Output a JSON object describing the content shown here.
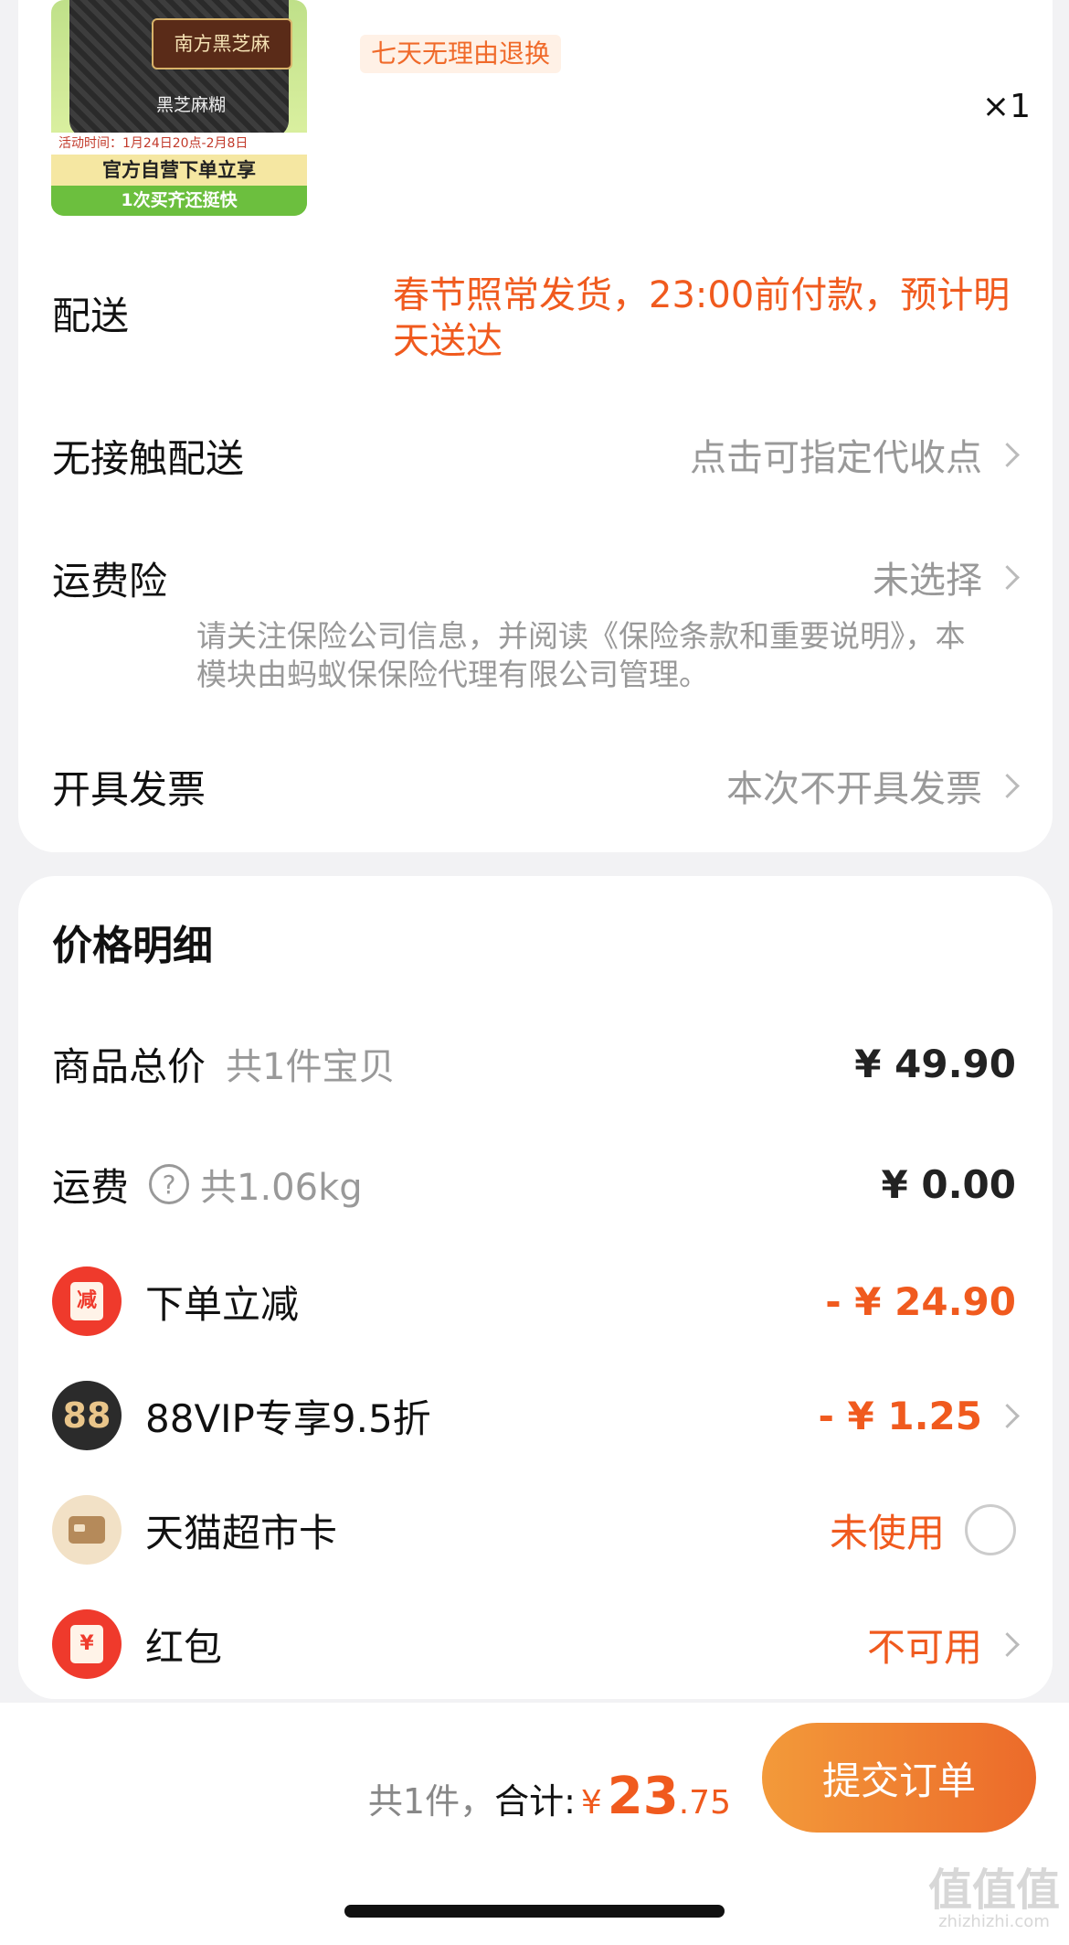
{
  "product": {
    "image_brand_text": "南方黑芝麻",
    "image_product_text": "黑芝麻糊",
    "image_activity_text": "活动时间：1月24日20点-2月8日",
    "image_promo_line1": "官方自营下单立享",
    "image_promo_line2": "1次买齐还挺快",
    "return_tag": "七天无理由退换",
    "quantity": "×1"
  },
  "order_info": {
    "delivery_label": "配送",
    "delivery_value": "春节照常发货，23:00前付款，预计明天送达",
    "contactless_label": "无接触配送",
    "contactless_value": "点击可指定代收点",
    "insurance_label": "运费险",
    "insurance_value": "未选择",
    "insurance_note": "请关注保险公司信息，并阅读《保险条款和重要说明》，本模块由蚂蚁保保险代理有限公司管理。",
    "invoice_label": "开具发票",
    "invoice_value": "本次不开具发票"
  },
  "price_detail": {
    "title": "价格明细",
    "items_label": "商品总价",
    "items_sub": "共1件宝贝",
    "items_value": "¥ 49.90",
    "shipping_label": "运费",
    "shipping_help_icon": "?",
    "shipping_sub": "共1.06kg",
    "shipping_value": "¥ 0.00",
    "discount_icon_text": "减",
    "discount_label": "下单立减",
    "discount_value": "- ¥ 24.90",
    "vip_icon_text": "88",
    "vip_label": "88VIP专享9.5折",
    "vip_value": "- ¥ 1.25",
    "card_label": "天猫超市卡",
    "card_value": "未使用",
    "redpacket_icon_text": "¥",
    "redpacket_label": "红包",
    "redpacket_value": "不可用"
  },
  "footer": {
    "count_text": "共1件，",
    "total_label": "合计:",
    "currency": "¥",
    "total_int": "23",
    "total_dec": ".75",
    "submit_label": "提交订单",
    "watermark": "值值值",
    "watermark_url": "zhizhizhi.com"
  },
  "colors": {
    "accent": "#f05a1e",
    "button_start": "#f39a3a",
    "button_end": "#ec6a2a",
    "muted": "#999999"
  }
}
